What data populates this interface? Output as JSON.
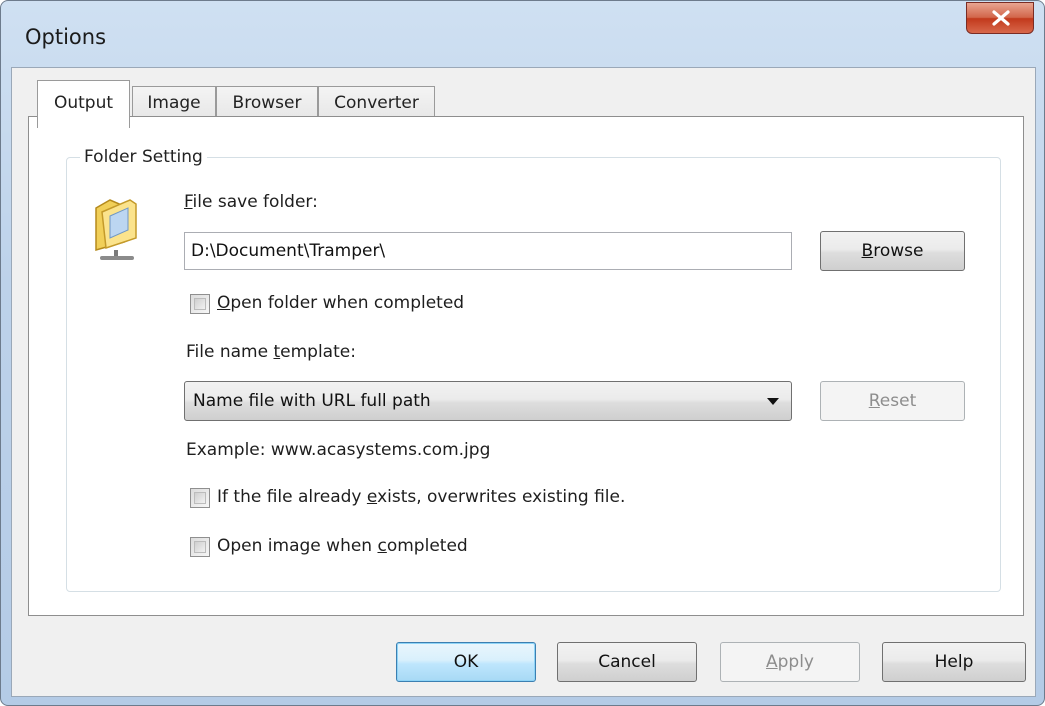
{
  "window": {
    "title": "Options"
  },
  "tabs": [
    "Output",
    "Image",
    "Browser",
    "Converter"
  ],
  "group": {
    "legend": "Folder Setting",
    "file_save_folder_label": {
      "accel": "F",
      "rest": "ile save folder:"
    },
    "file_save_folder_value": "D:\\Document\\Tramper\\",
    "browse_button": {
      "accel": "B",
      "rest": "rowse"
    },
    "open_folder": {
      "accel": "O",
      "rest": "pen folder when completed"
    },
    "template_label": {
      "pre": "File name ",
      "accel": "t",
      "rest": "emplate:"
    },
    "template_selected": "Name file with URL full path",
    "reset_button": {
      "accel": "R",
      "rest": "eset"
    },
    "example": "Example: www.acasystems.com.jpg",
    "overwrite": {
      "pre": "If the file already ",
      "accel": "e",
      "rest": "xists, overwrites existing file."
    },
    "open_image": {
      "pre": "Open image when ",
      "accel": "c",
      "rest": "ompleted"
    }
  },
  "footer": {
    "ok": "OK",
    "cancel": "Cancel",
    "apply": {
      "accel": "A",
      "rest": "pply"
    },
    "help": "Help"
  },
  "icons": {
    "close": "close-icon",
    "folder": "folder-network-icon",
    "dropdown": "chevron-down-icon"
  }
}
